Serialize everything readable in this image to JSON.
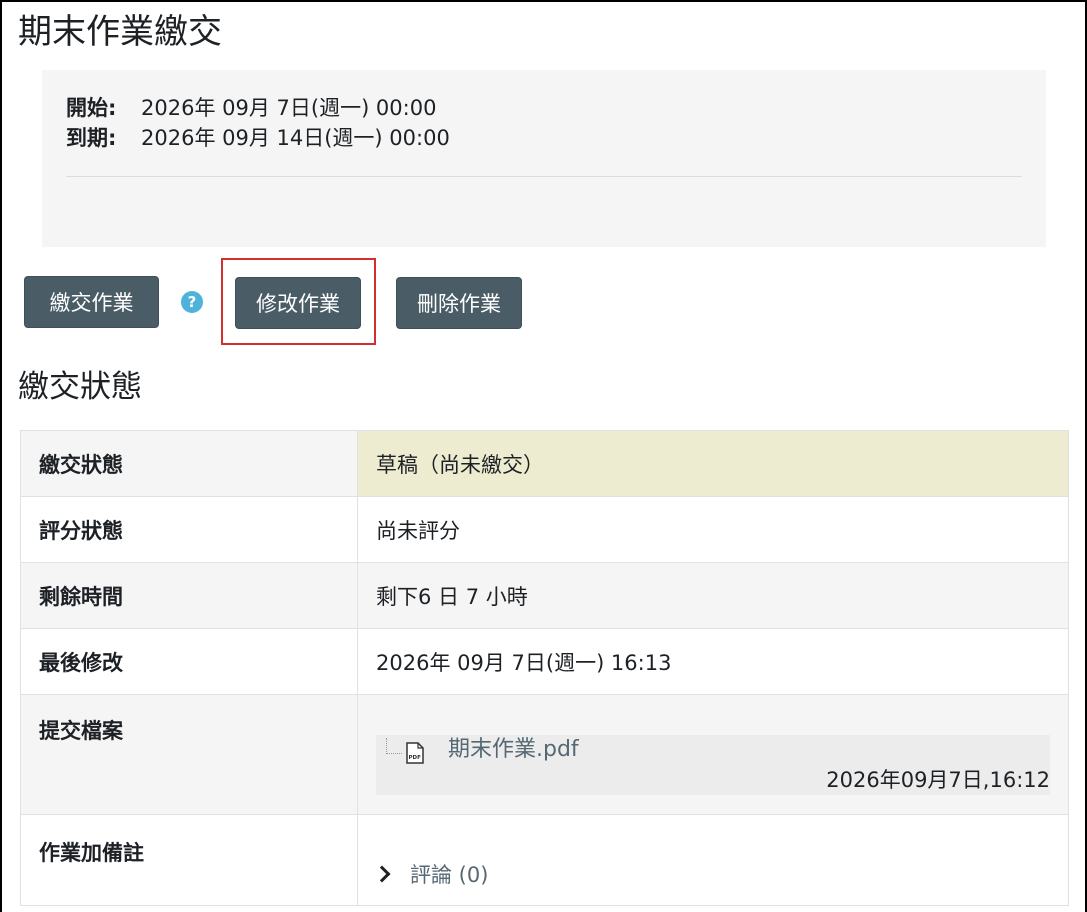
{
  "page_title": "期末作業繳交",
  "dates": {
    "open_label": "開始:",
    "open_value": "2026年 09月 7日(週一) 00:00",
    "due_label": "到期:",
    "due_value": "2026年 09月 14日(週一) 00:00"
  },
  "buttons": {
    "submit": "繳交作業",
    "help": "?",
    "edit": "修改作業",
    "delete": "刪除作業"
  },
  "section_title": "繳交狀態",
  "status": {
    "submission_label": "繳交狀態",
    "submission_value": "草稿（尚未繳交）",
    "grading_label": "評分狀態",
    "grading_value": "尚未評分",
    "remaining_label": "剩餘時間",
    "remaining_value": "剩下6 日 7 小時",
    "modified_label": "最後修改",
    "modified_value": "2026年 09月 7日(週一) 16:13",
    "files_label": "提交檔案",
    "file_name": "期末作業.pdf",
    "file_time": "2026年09月7日,16:12",
    "notes_label": "作業加備註",
    "comments_label": "評論 (0)"
  },
  "colors": {
    "button_bg": "#4a5d66",
    "draft_highlight": "#eeecd0",
    "link": "#566873",
    "help_icon": "#4fb3d9",
    "annotation_box": "#d22f2f"
  }
}
